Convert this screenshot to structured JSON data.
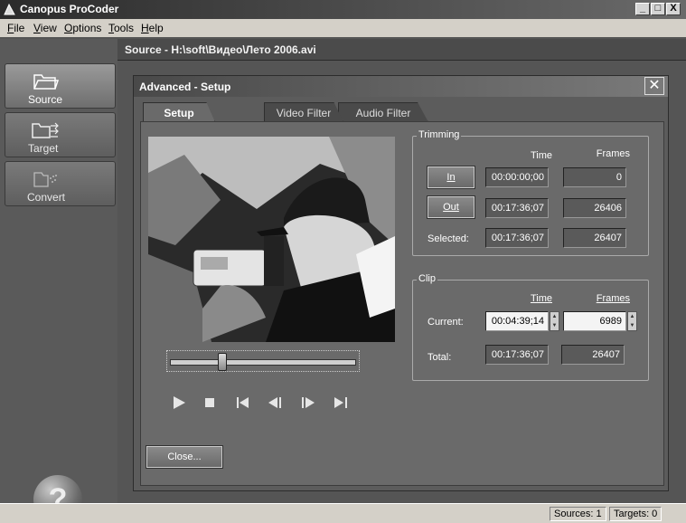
{
  "window": {
    "title": "Canopus ProCoder",
    "minimize": "_",
    "maximize": "□",
    "close": "X"
  },
  "menu": [
    "File",
    "View",
    "Options",
    "Tools",
    "Help"
  ],
  "source_bar": {
    "text": "Source - H:\\soft\\Видео\\Лето 2006.avi"
  },
  "sidebar": {
    "items": [
      {
        "label": "Source",
        "icon": "folder-icon",
        "active": true
      },
      {
        "label": "Target",
        "icon": "folder-arrows-icon",
        "active": false
      },
      {
        "label": "Convert",
        "icon": "convert-icon",
        "active": false
      }
    ],
    "help": "?"
  },
  "dialog": {
    "title": "Advanced - Setup",
    "close": "✕",
    "tabs": [
      {
        "label": "Setup",
        "active": true
      },
      {
        "label": "Video Filter",
        "active": false
      },
      {
        "label": "Audio Filter",
        "active": false
      }
    ],
    "seek_position": 0.27,
    "trimming": {
      "title": "Trimming",
      "time_header": "Time",
      "frames_header": "Frames",
      "in_button": "In",
      "out_button": "Out",
      "selected_label": "Selected:",
      "in_time": "00:00:00;00",
      "in_frames": "0",
      "out_time": "00:17:36;07",
      "out_frames": "26406",
      "selected_time": "00:17:36;07",
      "selected_frames": "26407"
    },
    "clip": {
      "title": "Clip",
      "time_header": "Time",
      "frames_header": "Frames",
      "current_label": "Current:",
      "total_label": "Total:",
      "current_time": "00:04:39;14",
      "current_frames": "6989",
      "total_time": "00:17:36;07",
      "total_frames": "26407"
    },
    "close_button": "Close..."
  },
  "status": {
    "sources": "Sources: 1",
    "targets": "Targets: 0"
  }
}
